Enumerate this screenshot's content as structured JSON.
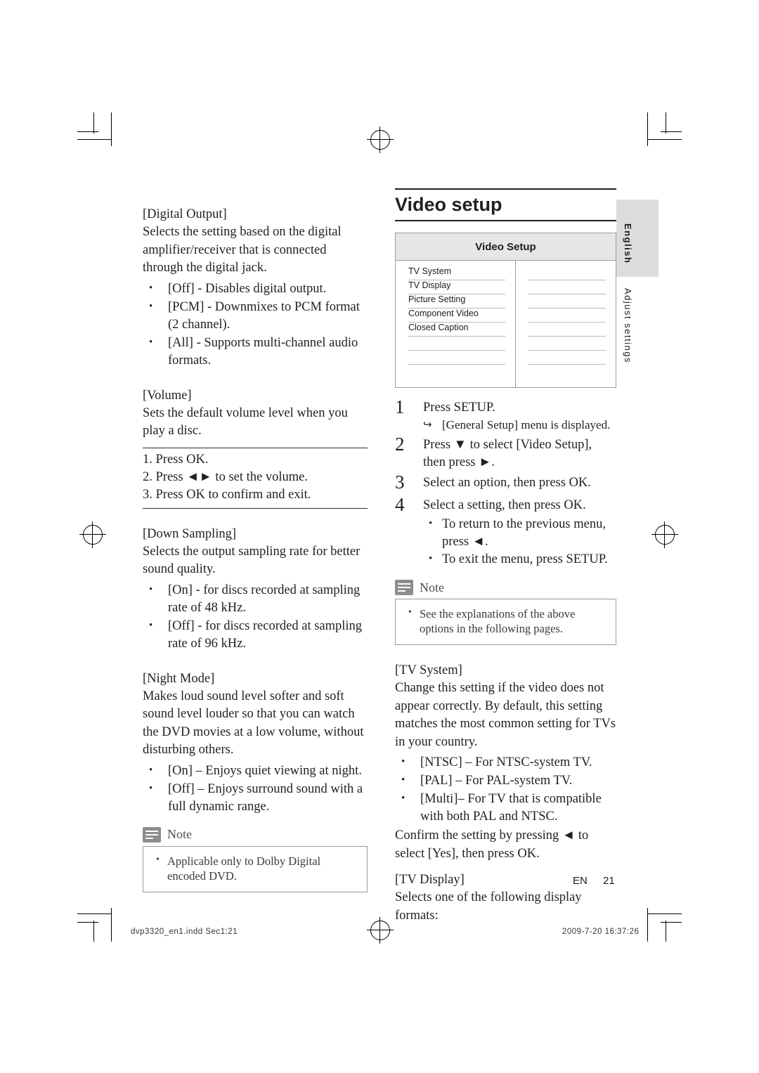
{
  "page": {
    "footer_lang": "EN",
    "page_number": "21",
    "imprint_left": "dvp3320_en1.indd   Sec1:21",
    "imprint_right": "2009-7-20   16:37:26",
    "side_tab_top": "English",
    "side_tab_bottom": "Adjust settings"
  },
  "left_column": {
    "sections": [
      {
        "heading": "[Digital Output]",
        "body": "Selects the setting based on the digital amplifier/receiver that is connected through the digital jack.",
        "bullets": [
          "[Off] - Disables digital output.",
          "[PCM] - Downmixes to PCM format (2 channel).",
          "[All] - Supports multi-channel audio formats."
        ]
      },
      {
        "heading": "[Volume]",
        "body": "Sets the default volume level when you play a disc.",
        "steps": [
          "1. Press OK.",
          "2. Press ◄► to set the volume.",
          "3. Press OK to confirm and exit."
        ]
      },
      {
        "heading": "[Down Sampling]",
        "body": "Selects the output sampling rate for better sound quality.",
        "bullets": [
          "[On] - for discs recorded at sampling rate of 48 kHz.",
          "[Off] - for discs recorded at sampling rate of 96 kHz."
        ]
      },
      {
        "heading": "[Night Mode]",
        "body": "Makes loud sound level softer and soft sound level louder so that you can watch the DVD movies at a low volume, without disturbing others.",
        "bullets": [
          "[On] – Enjoys quiet viewing at night.",
          "[Off] – Enjoys surround sound with a full dynamic range."
        ]
      }
    ],
    "note": {
      "label": "Note",
      "items": [
        "Applicable only to Dolby Digital encoded DVD."
      ]
    }
  },
  "right_column": {
    "title": "Video setup",
    "screenshot": {
      "header": "Video Setup",
      "rows": [
        "TV System",
        "TV Display",
        "Picture Setting",
        "Component Video",
        "Closed Caption"
      ]
    },
    "steps": [
      {
        "num": "1",
        "text": "Press SETUP.",
        "sub_arrow": "[General Setup] menu is displayed."
      },
      {
        "num": "2",
        "text": "Press ▼ to select [Video Setup], then press ►."
      },
      {
        "num": "3",
        "text": "Select an option, then press OK."
      },
      {
        "num": "4",
        "text": "Select a setting, then press OK.",
        "subs": [
          "To return to the previous menu, press ◄.",
          "To exit the menu, press SETUP."
        ]
      }
    ],
    "note": {
      "label": "Note",
      "items": [
        "See the explanations of the above options in the following pages."
      ]
    },
    "sections": [
      {
        "heading": "[TV System]",
        "body": "Change this setting if the video does not appear correctly. By default, this setting matches the most common setting for TVs in your country.",
        "bullets": [
          "[NTSC] – For NTSC-system TV.",
          "[PAL] – For PAL-system TV.",
          "[Multi]– For TV that is compatible with both PAL and NTSC."
        ],
        "after": "Confirm the setting by pressing ◄ to select [Yes], then press OK."
      },
      {
        "heading": "[TV Display]",
        "body": "Selects one of the following display formats:"
      }
    ]
  }
}
